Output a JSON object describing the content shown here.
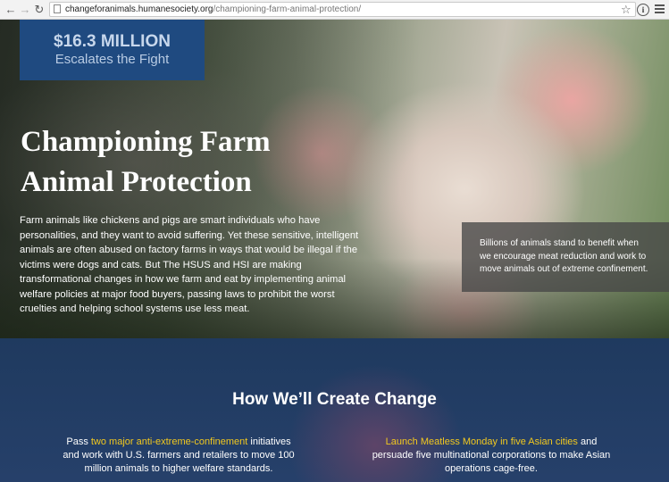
{
  "browser": {
    "url_host": "changeforanimals.humanesociety.org",
    "url_path": "/championing-farm-animal-protection/"
  },
  "hero": {
    "stat_amount": "$16.3 MILLION",
    "stat_subtitle": "Escalates the Fight",
    "title_line1": "Championing Farm",
    "title_line2": "Animal Protection",
    "body": "Farm animals like chickens and pigs are smart individuals who have personalities, and they want to avoid suffering. Yet these sensitive, intelligent animals are often abused on factory farms in ways that would be illegal if the victims were dogs and cats. But The HSUS and HSI are making transformational changes in how we farm and eat by implementing animal welfare policies at major food buyers, passing laws to prohibit the worst cruelties and helping school systems use less meat.",
    "callout": "Billions of animals stand to benefit when we encourage meat reduction and work to move animals out of extreme confinement."
  },
  "section": {
    "title": "How We’ll Create Change",
    "left": {
      "prefix": "Pass ",
      "link": "two major anti-extreme-confinement",
      "suffix": " initiatives and work with U.S. farmers and retailers to move 100 million animals to higher welfare standards."
    },
    "right": {
      "link": "Launch Meatless Monday in five Asian cities",
      "suffix": " and persuade five multinational corporations to make Asian operations cage-free."
    }
  },
  "colors": {
    "stat_box": "#1f4a80",
    "link_yellow": "#f2c81f",
    "section_bg": "#1f3a5f"
  },
  "icons": [
    "back-arrow-icon",
    "forward-arrow-icon",
    "reload-icon",
    "page-icon",
    "bookmark-star-icon",
    "extension-icon",
    "menu-icon"
  ]
}
